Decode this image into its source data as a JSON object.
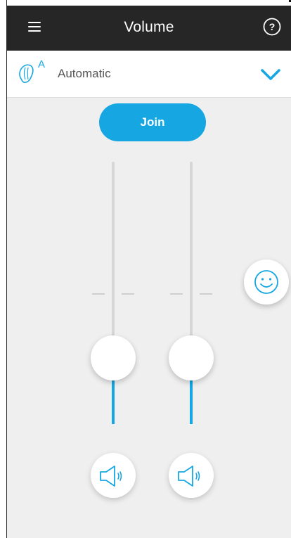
{
  "header": {
    "title": "Volume",
    "menu_icon": "hamburger-menu-icon",
    "help_icon": "help-circle-icon"
  },
  "program": {
    "icon": "hearing-aid-automatic-icon",
    "icon_badge": "A",
    "label": "Automatic",
    "dropdown_icon": "chevron-down-icon"
  },
  "controls": {
    "join_label": "Join",
    "feedback_icon": "smiley-icon"
  },
  "sliders": [
    {
      "side": "left",
      "level": 0.2,
      "speaker_icon": "speaker-icon"
    },
    {
      "side": "right",
      "level": 0.2,
      "speaker_icon": "speaker-icon"
    }
  ],
  "colors": {
    "header_bg": "#262626",
    "accent": "#16a7e3",
    "background": "#efefef",
    "track": "#d6d6d6"
  }
}
